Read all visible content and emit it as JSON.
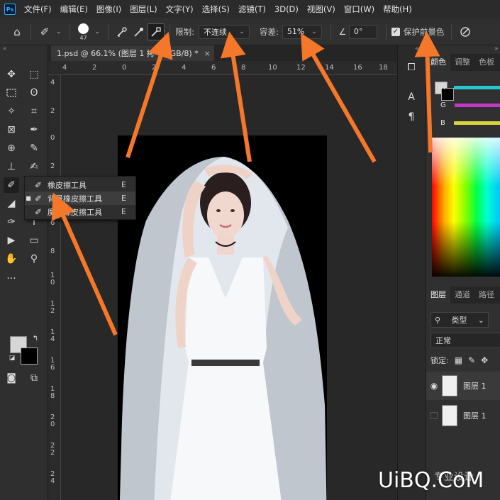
{
  "app": {
    "logo": "Ps",
    "menu": [
      "文件(F)",
      "编辑(E)",
      "图像(I)",
      "图层(L)",
      "文字(Y)",
      "选择(S)",
      "滤镜(T)",
      "3D(D)",
      "视图(V)",
      "窗口(W)",
      "帮助(H)"
    ]
  },
  "options": {
    "brush_size": "47",
    "limit_label": "限制:",
    "limit_value": "不连续",
    "tolerance_label": "容差:",
    "tolerance_value": "51%",
    "angle_value": "0°",
    "protect_label": "保护前景色"
  },
  "document": {
    "tab_title": "1.psd @ 66.1% (图层 1 拷",
    "tab_suffix": "RGB/8) *",
    "close": "×"
  },
  "ruler_top": [
    "4",
    "2",
    "0",
    "2",
    "4",
    "6",
    "8",
    "10",
    "12",
    "14",
    "16",
    "18"
  ],
  "ruler_left": [
    "4",
    "2",
    "0",
    "2",
    "4",
    "6",
    "8",
    "1\n0",
    "1\n2",
    "1\n4",
    "1\n6",
    "1\n8",
    "2\n0",
    "2\n2",
    "2\n4"
  ],
  "flyout": {
    "items": [
      {
        "label": "橡皮擦工具",
        "key": "E"
      },
      {
        "label": "背景橡皮擦工具",
        "key": "E"
      },
      {
        "label": "魔术橡皮擦工具",
        "key": "E"
      }
    ]
  },
  "panels": {
    "color_tabs": [
      "颜色",
      "调整",
      "色板"
    ],
    "sliders": [
      "R",
      "G",
      "B"
    ],
    "layers_tabs": [
      "图层",
      "通道",
      "路径"
    ],
    "filter_kind": "类型",
    "blend_mode": "正常",
    "lock_label": "锁定:",
    "layers": [
      "图层 1",
      "图层 1"
    ]
  },
  "watermark": {
    "text": "UiBQ.CoM",
    "cn": "专业设计"
  },
  "colors": {
    "arrow": "#f5782a",
    "r": "#25c7d0",
    "g": "#c339c9",
    "b": "#d8d33a"
  }
}
